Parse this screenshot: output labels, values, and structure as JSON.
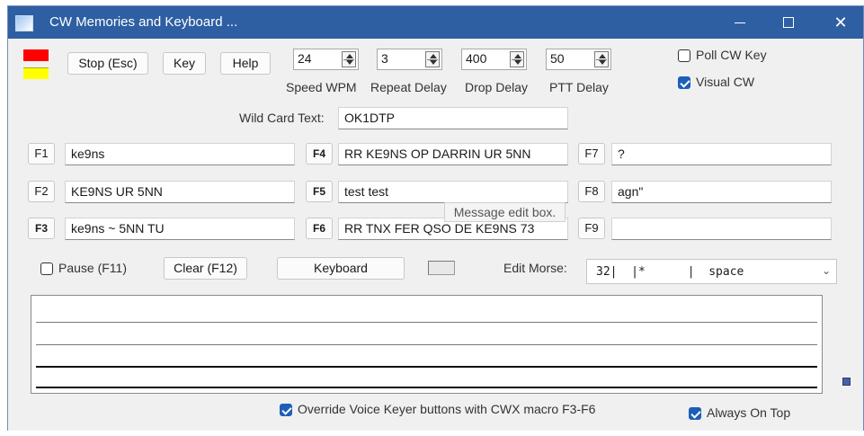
{
  "window": {
    "title": "CW Memories and Keyboard ...",
    "controls": {
      "minimize": "—",
      "maximize": "☐",
      "close": "✕"
    }
  },
  "indicators": {
    "red": "#ff0000",
    "yellow": "#ffff00"
  },
  "toolbar": {
    "stop_label": "Stop (Esc)",
    "key_label": "Key",
    "help_label": "Help"
  },
  "spinners": [
    {
      "value": "24",
      "label": "Speed WPM"
    },
    {
      "value": "3",
      "label": "Repeat Delay"
    },
    {
      "value": "400",
      "label": "Drop Delay"
    },
    {
      "value": "50",
      "label": "PTT Delay"
    }
  ],
  "options": {
    "poll_cw_key": "Poll CW Key",
    "visual_cw": "Visual CW",
    "poll_cw_key_checked": false,
    "visual_cw_checked": true
  },
  "wildcard": {
    "label": "Wild Card Text:",
    "value": "OK1DTP"
  },
  "memories": [
    {
      "key": "F1",
      "text": "ke9ns"
    },
    {
      "key": "F2",
      "text": "KE9NS UR 5NN"
    },
    {
      "key": "F3",
      "text": "ke9ns ~ 5NN TU"
    },
    {
      "key": "F4",
      "text": "RR KE9NS OP DARRIN UR 5NN"
    },
    {
      "key": "F5",
      "text": "test test"
    },
    {
      "key": "F6",
      "text": "RR TNX FER QSO DE KE9NS 73"
    },
    {
      "key": "F7",
      "text": "?"
    },
    {
      "key": "F8",
      "text": "agn\""
    },
    {
      "key": "F9",
      "text": ""
    }
  ],
  "tooltip": "Message edit box.",
  "controls_row": {
    "pause_label": "Pause (F11)",
    "clear_label": "Clear (F12)",
    "keyboard_label": "Keyboard",
    "edit_morse_label": "Edit Morse:",
    "edit_morse_value": "32|  |*      |  space"
  },
  "footer": {
    "override_label": "Override Voice Keyer buttons with CWX macro F3-F6",
    "always_on_top_label": "Always On Top"
  },
  "colors": {
    "titlebar": "#2e5fa3",
    "checkbox_accent": "#1d5fb8"
  }
}
